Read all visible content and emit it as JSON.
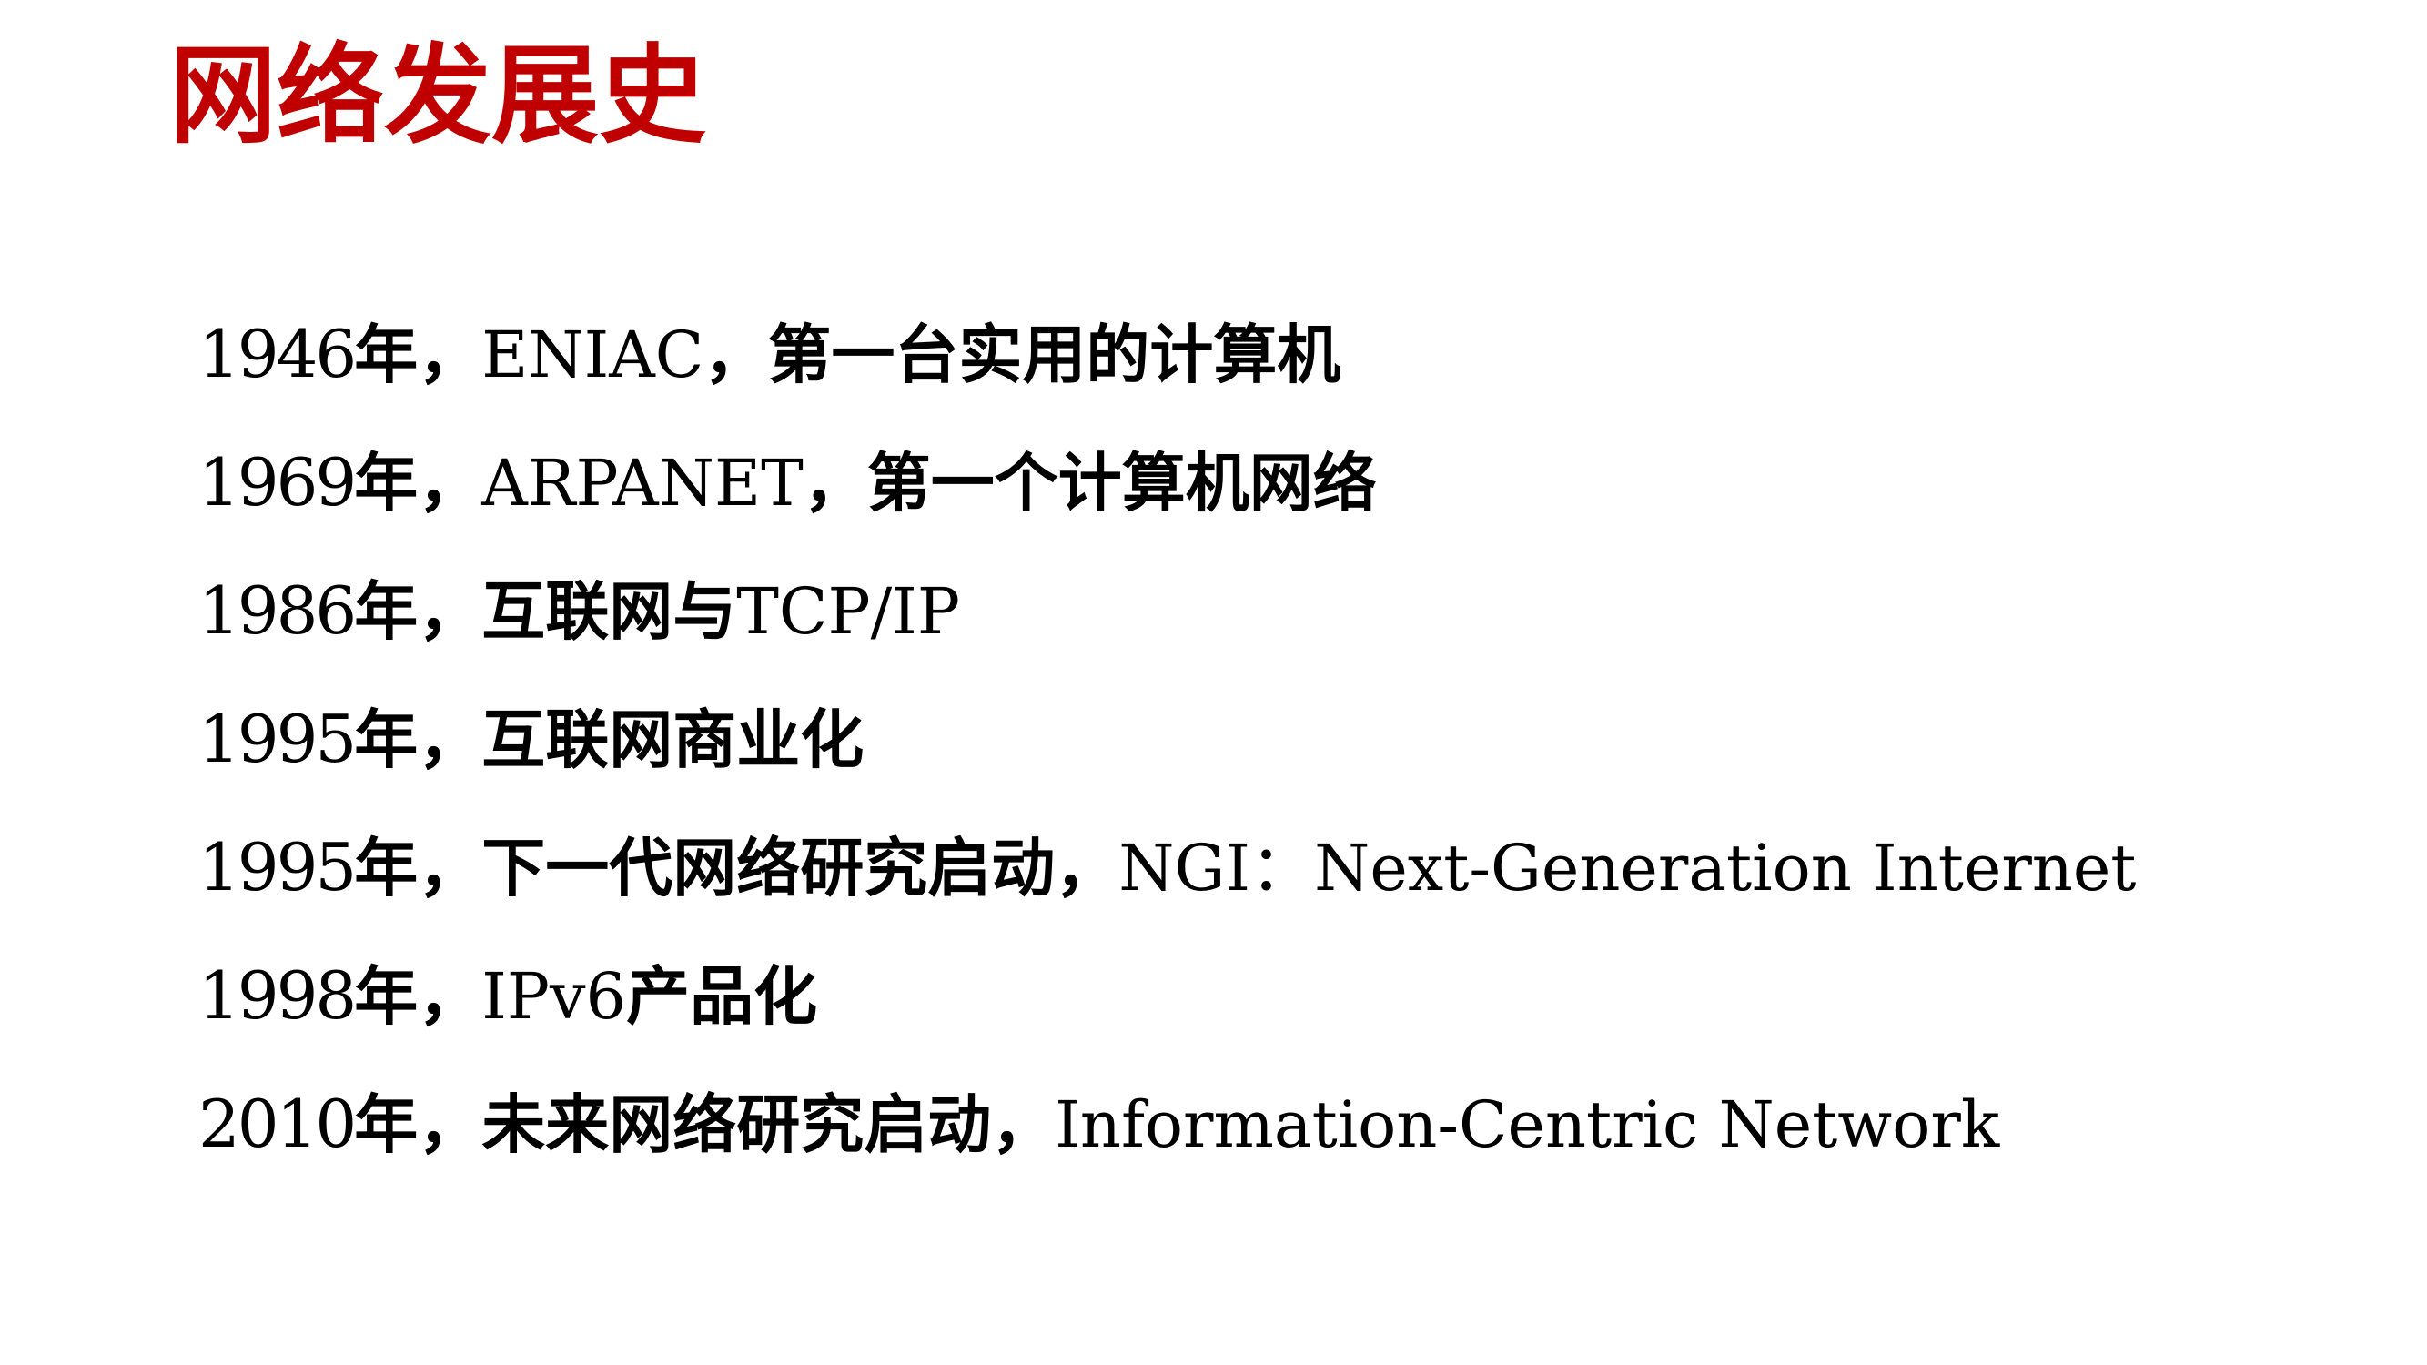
{
  "slide": {
    "title": "网络发展史",
    "title_color": "#c00000",
    "items": [
      {
        "year": "1946",
        "year_suffix": "年，",
        "name": "ENIAC",
        "sep": "，",
        "desc": "第一台实用的计算机",
        "tail_sep": "",
        "tail": ""
      },
      {
        "year": "1969",
        "year_suffix": "年，",
        "name": "ARPANET",
        "sep": "，",
        "desc": "第一个计算机网络",
        "tail_sep": "",
        "tail": ""
      },
      {
        "year": "1986",
        "year_suffix": "年，",
        "name": "",
        "sep": "",
        "desc": "互联网与",
        "tail_sep": "",
        "tail": "TCP/IP"
      },
      {
        "year": "1995",
        "year_suffix": "年，",
        "name": "",
        "sep": "",
        "desc": "互联网商业化",
        "tail_sep": "",
        "tail": ""
      },
      {
        "year": "1995",
        "year_suffix": "年，",
        "name": "",
        "sep": "",
        "desc": "下一代网络研究启动，",
        "tail_sep": "NGI：",
        "tail": "Next-Generation Internet"
      },
      {
        "year": "1998",
        "year_suffix": "年，",
        "name": "IPv6",
        "sep": "",
        "desc": "产品化",
        "tail_sep": "",
        "tail": ""
      },
      {
        "year": "2010",
        "year_suffix": "年，",
        "name": "",
        "sep": "",
        "desc": "未来网络研究启动，",
        "tail_sep": "",
        "tail": "Information-Centric Network"
      }
    ]
  }
}
